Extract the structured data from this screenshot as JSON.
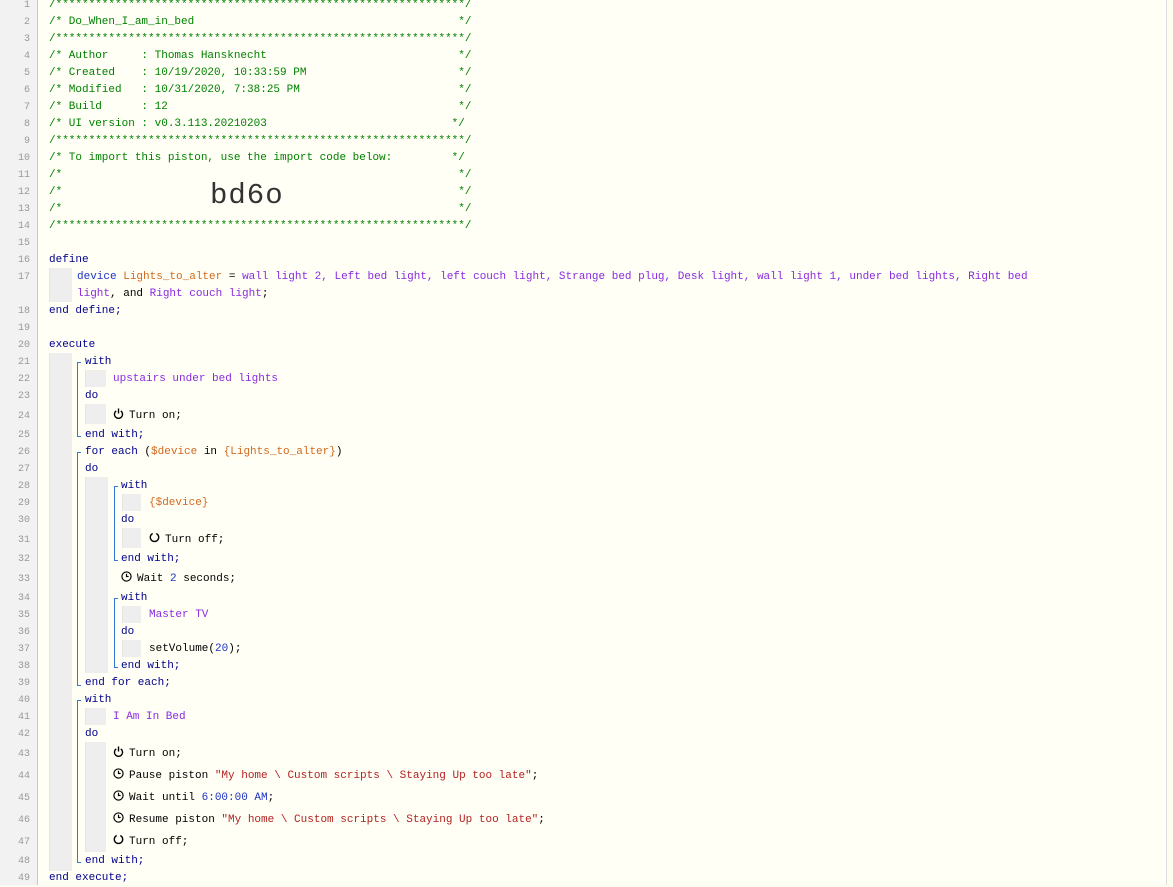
{
  "line_numbers": [
    "1",
    "2",
    "3",
    "4",
    "5",
    "6",
    "7",
    "8",
    "9",
    "10",
    "11",
    "12",
    "13",
    "14",
    "15",
    "16",
    "17",
    "18",
    "19",
    "20",
    "21",
    "22",
    "23",
    "24",
    "25",
    "26",
    "27",
    "28",
    "29",
    "30",
    "31",
    "32",
    "33",
    "34",
    "35",
    "36",
    "37",
    "38",
    "39",
    "40",
    "41",
    "42",
    "43",
    "44",
    "45",
    "46",
    "47",
    "48",
    "49"
  ],
  "header": {
    "stars": "/**************************************************************/",
    "title": "/* Do_When_I_am_in_bed                                        */",
    "author": "/* Author     : Thomas Hansknecht                             */",
    "created": "/* Created    : 10/19/2020, 10:33:59 PM                       */",
    "modified": "/* Modified   : 10/31/2020, 7:38:25 PM                        */",
    "build": "/* Build      : 12                                            */",
    "ui_version": "/* UI version : v0.3.113.20210203                            */",
    "import_note": "/* To import this piston, use the import code below:         */",
    "blank_line": "/*                                                            */",
    "import_code": "bd6o"
  },
  "define": {
    "open": "define",
    "device_kw": "device",
    "var_name": "Lights_to_alter",
    "eq": " = ",
    "devices_line1": "wall light 2, Left bed light, left couch light, Strange bed plug, Desk light, wall light 1, under bed lights, Right bed",
    "devices_line2a": "light",
    "and": ", and ",
    "devices_line2b": "Right couch light",
    "semi": ";",
    "close": "end define;"
  },
  "execute": {
    "open": "execute",
    "with1": "with",
    "device1": "upstairs under bed lights",
    "do1": "do",
    "turn_on": "Turn on;",
    "end_with1": "end with;",
    "for_each": "for each",
    "paren_open": " (",
    "loop_var": "$device",
    "in_kw": " in ",
    "loop_list": "{Lights_to_alter}",
    "paren_close": ")",
    "do2": "do",
    "with2": "with",
    "device2": "{$device}",
    "do3": "do",
    "turn_off": "Turn off;",
    "end_with2": "end with;",
    "wait_prefix": "Wait ",
    "wait_num": "2",
    "wait_suffix": " seconds;",
    "with3": "with",
    "device3": "Master TV",
    "do4": "do",
    "set_volume_prefix": "setVolume(",
    "set_volume_num": "20",
    "set_volume_suffix": ");",
    "end_with3": "end with;",
    "end_for_each": "end for each;",
    "with4": "with",
    "device4": "I Am In Bed",
    "do5": "do",
    "turn_on2": "Turn on;",
    "pause_prefix": "Pause piston ",
    "pause_target": "\"My home \\ Custom scripts \\ Staying Up too late\"",
    "stmt_end": ";",
    "wait_until_prefix": "Wait until ",
    "wait_until_time": "6:00:00 AM",
    "resume_prefix": "Resume piston ",
    "resume_target": "\"My home \\ Custom scripts \\ Staying Up too late\"",
    "turn_off2": "Turn off;",
    "end_with4": "end with;",
    "close": "end execute;"
  }
}
